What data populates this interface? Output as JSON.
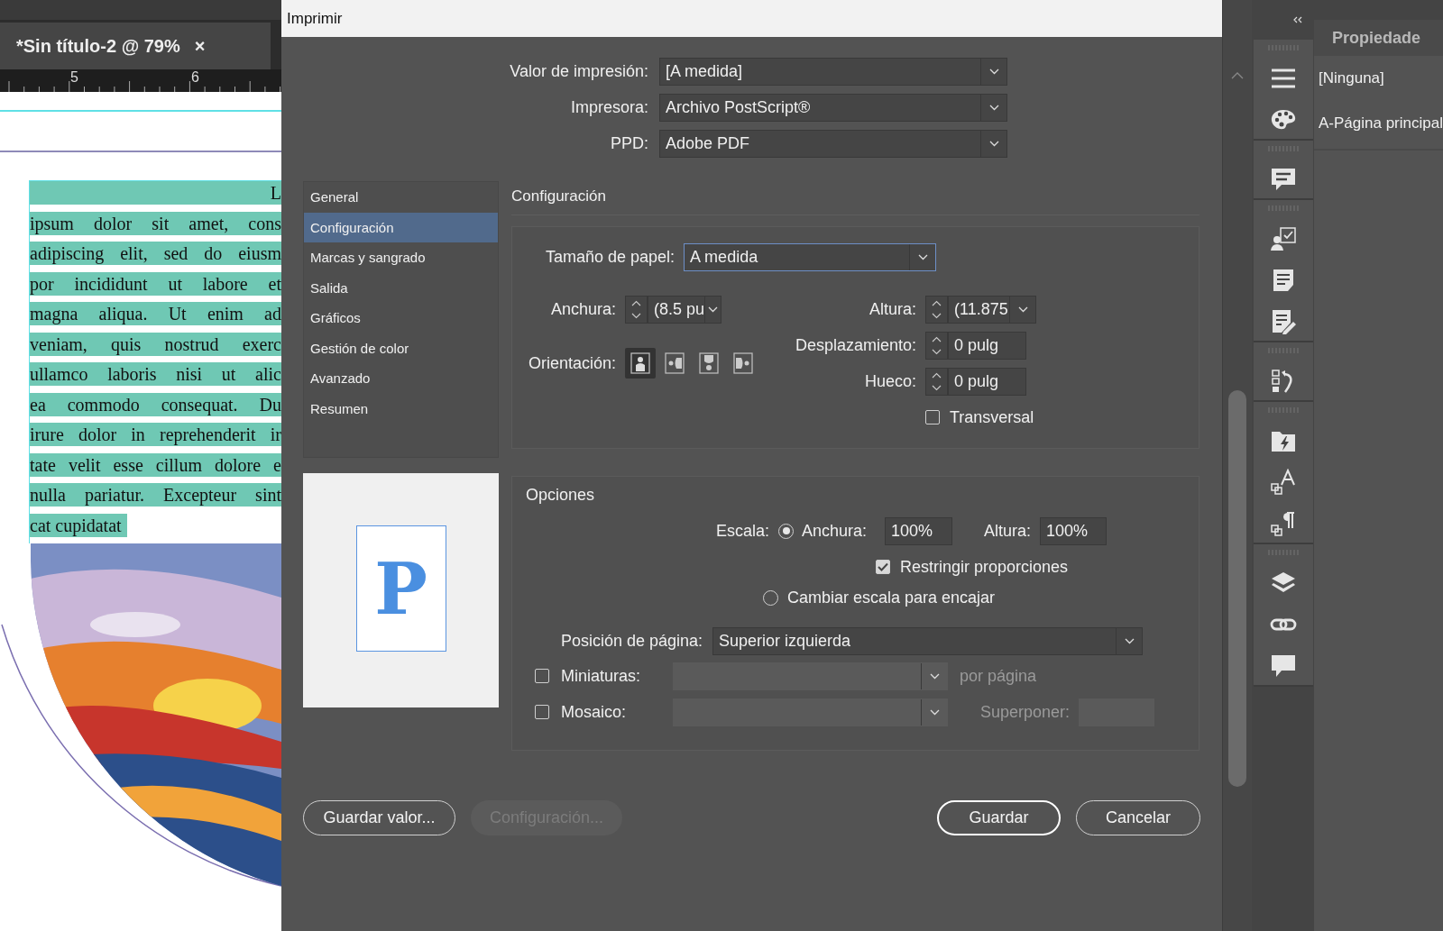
{
  "document": {
    "tab": {
      "title": "*Sin título-2 @ 79%",
      "close": "×"
    },
    "ruler": [
      "5",
      "6"
    ],
    "lines": [
      "L",
      "ipsum dolor sit amet, cons",
      "adipiscing elit, sed do eiusm",
      "por incididunt ut labore et",
      "magna aliqua. Ut enim ad",
      "veniam, quis nostrud exerc",
      "ullamco laboris nisi ut alic",
      "ea commodo consequat. Du",
      "irure dolor in reprehenderit ir",
      "tate velit esse cillum dolore e",
      "nulla pariatur. Excepteur sint",
      "cat cupidatat"
    ]
  },
  "dialog": {
    "title": "Imprimir",
    "top_fields": [
      {
        "label": "Valor de impresión:",
        "value": "[A medida]"
      },
      {
        "label": "Impresora:",
        "value": "Archivo PostScript®"
      },
      {
        "label": "PPD:",
        "value": "Adobe PDF"
      }
    ],
    "nav": [
      {
        "label": "General",
        "selected": false
      },
      {
        "label": "Configuración",
        "selected": true
      },
      {
        "label": "Marcas y sangrado",
        "selected": false
      },
      {
        "label": "Salida",
        "selected": false
      },
      {
        "label": "Gráficos",
        "selected": false
      },
      {
        "label": "Gestión de color",
        "selected": false
      },
      {
        "label": "Avanzado",
        "selected": false
      },
      {
        "label": "Resumen",
        "selected": false
      }
    ],
    "preview": {
      "letter": "P"
    },
    "section_title": "Configuración",
    "paper_size": {
      "label": "Tamaño de papel:",
      "value": "A medida"
    },
    "width": {
      "label": "Anchura:",
      "value": "(8.5 pu"
    },
    "height": {
      "label": "Altura:",
      "value": "(11.875"
    },
    "orientation": {
      "label": "Orientación:",
      "options": [
        {
          "kind": "portrait",
          "selected": true
        },
        {
          "kind": "landscape",
          "selected": false
        },
        {
          "kind": "reverse-portrait",
          "selected": false
        },
        {
          "kind": "reverse-landscape",
          "selected": false
        }
      ]
    },
    "offset": {
      "label": "Desplazamiento:",
      "value": "0 pulg"
    },
    "gap": {
      "label": "Hueco:",
      "value": "0 pulg"
    },
    "transverse": {
      "label": "Transversal",
      "checked": false
    },
    "options": {
      "title": "Opciones",
      "scale_label": "Escala:",
      "scale_width": {
        "label": "Anchura:",
        "value": "100%",
        "selected": true
      },
      "scale_height": {
        "label": "Altura:",
        "value": "100%"
      },
      "constrain": {
        "label": "Restringir proporciones",
        "checked": true
      },
      "scale_to_fit": {
        "label": "Cambiar escala para encajar",
        "selected": false
      },
      "page_position": {
        "label": "Posición de página:",
        "value": "Superior izquierda"
      },
      "thumbnails": {
        "label": "Miniaturas:",
        "checked": false,
        "suffix": "por página"
      },
      "tile": {
        "label": "Mosaico:",
        "checked": false,
        "overlap_label": "Superponer:"
      }
    },
    "buttons": [
      {
        "label": "Guardar valor...",
        "kind": "secondary",
        "disabled": false
      },
      {
        "label": "Configuración...",
        "kind": "secondary",
        "disabled": true
      },
      {
        "label": "Guardar",
        "kind": "primary",
        "disabled": false
      },
      {
        "label": "Cancelar",
        "kind": "secondary",
        "disabled": false
      }
    ]
  },
  "properties": {
    "title": "Propiedade",
    "items": [
      "[Ninguna]",
      "A-Página principal"
    ]
  }
}
